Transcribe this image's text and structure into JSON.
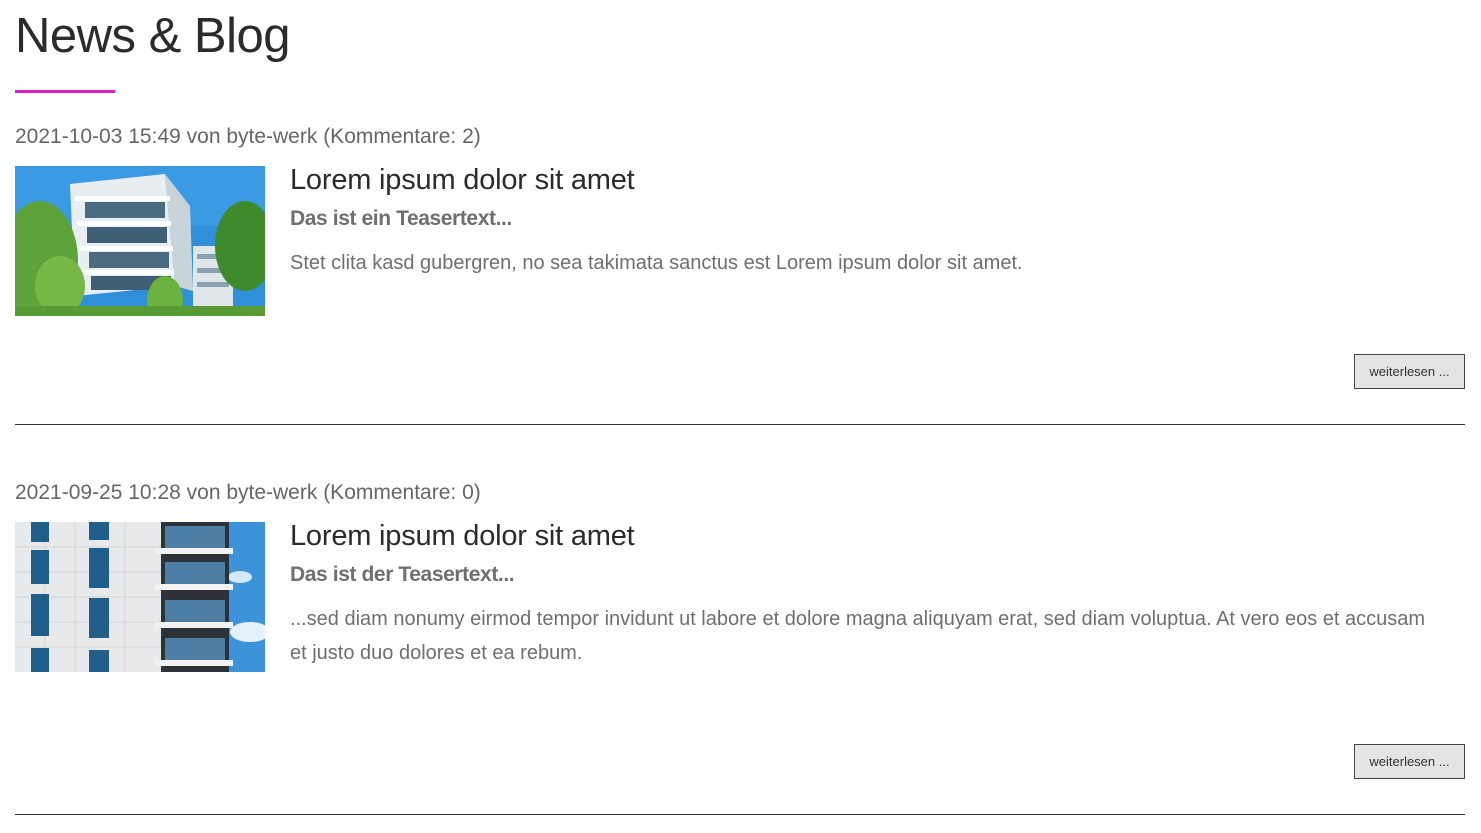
{
  "page": {
    "title": "News & Blog",
    "accent_color": "#e020c0"
  },
  "articles": [
    {
      "meta": "2021-10-03 15:49 von byte-werk (Kommentare: 2)",
      "image": "building-exterior-photo",
      "headline": "Lorem ipsum dolor sit amet",
      "teaser": "Das ist ein Teasertext...",
      "body": "Stet clita kasd gubergren, no sea takimata sanctus est Lorem ipsum dolor sit amet.",
      "read_more": "weiterlesen ..."
    },
    {
      "meta": "2021-09-25 10:28 von byte-werk (Kommentare: 0)",
      "image": "building-facade-photo",
      "headline": "Lorem ipsum dolor sit amet",
      "teaser": "Das ist der Teasertext...",
      "body": "...sed diam nonumy eirmod tempor invidunt ut labore et dolore magna aliquyam erat, sed diam voluptua. At vero eos et accusam et justo duo dolores et ea rebum.",
      "read_more": "weiterlesen ..."
    }
  ]
}
